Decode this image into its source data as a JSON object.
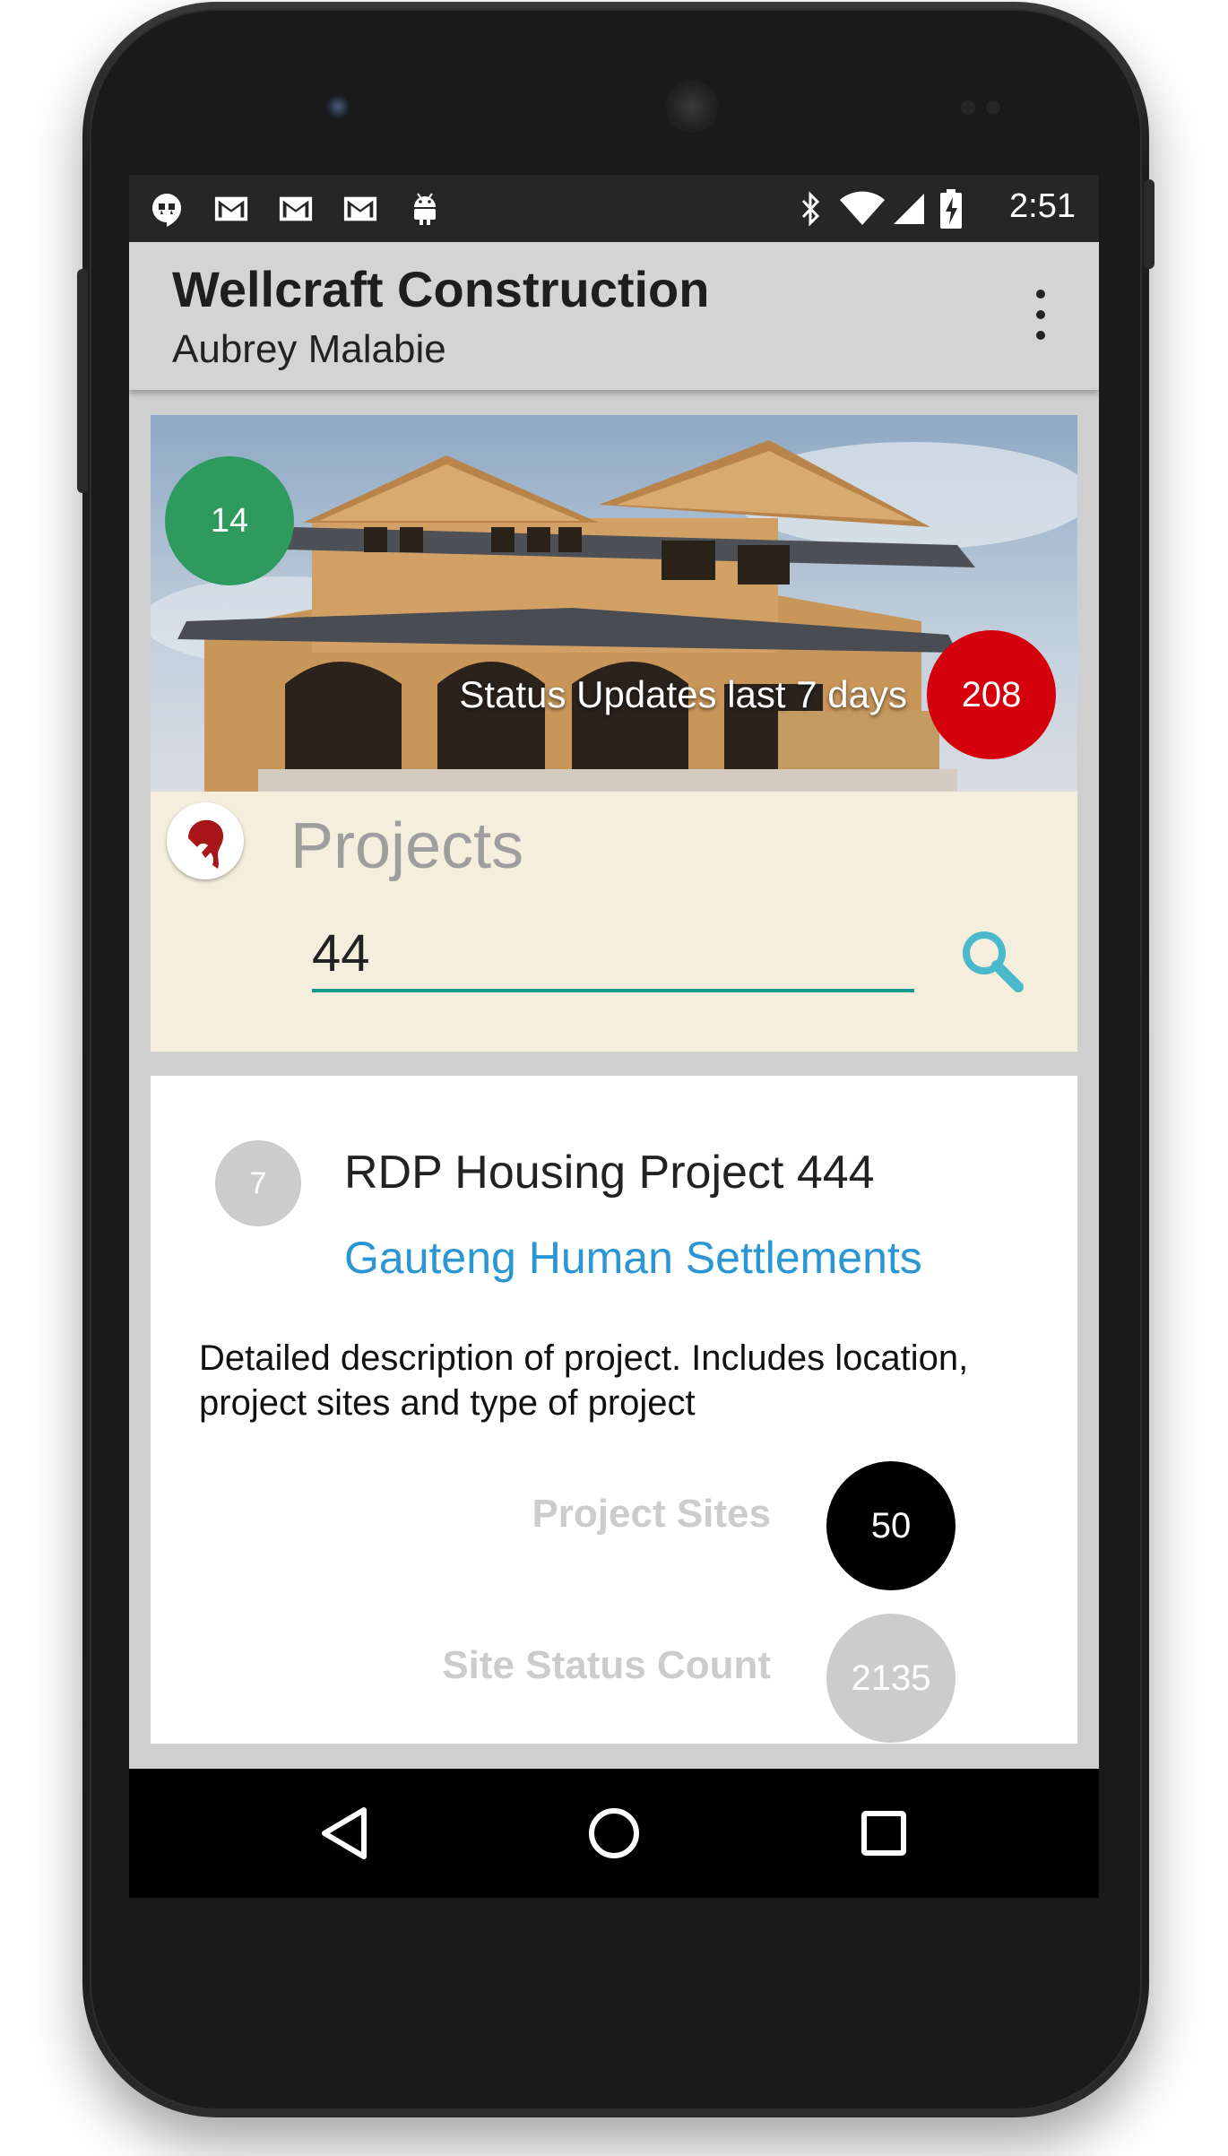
{
  "status_bar": {
    "time": "2:51",
    "left_icons": [
      "hangouts-icon",
      "gmail-icon",
      "gmail-icon",
      "gmail-icon",
      "android-icon"
    ],
    "right_icons": [
      "bluetooth-icon",
      "wifi-icon",
      "cell-signal-icon",
      "battery-charging-icon"
    ]
  },
  "app_bar": {
    "title": "Wellcraft Construction",
    "subtitle": "Aubrey Malabie"
  },
  "hero": {
    "left_badge": "14",
    "status_text": "Status Updates last 7 days",
    "status_count": "208"
  },
  "projects": {
    "title": "Projects",
    "search_value": "44"
  },
  "project_card": {
    "number": "7",
    "name": "RDP Housing Project 444",
    "client": "Gauteng Human Settlements",
    "description": "Detailed description of project. Includes location, project sites and type of project",
    "stats": [
      {
        "label": "Project Sites",
        "value": "50"
      },
      {
        "label": "Site Status Count",
        "value": "2135"
      }
    ]
  },
  "colors": {
    "accent_teal": "#169b8e",
    "link_blue": "#2a96d3",
    "badge_green": "#2e9a5e",
    "badge_red": "#d4000c",
    "panel_cream": "#f5eedc"
  }
}
